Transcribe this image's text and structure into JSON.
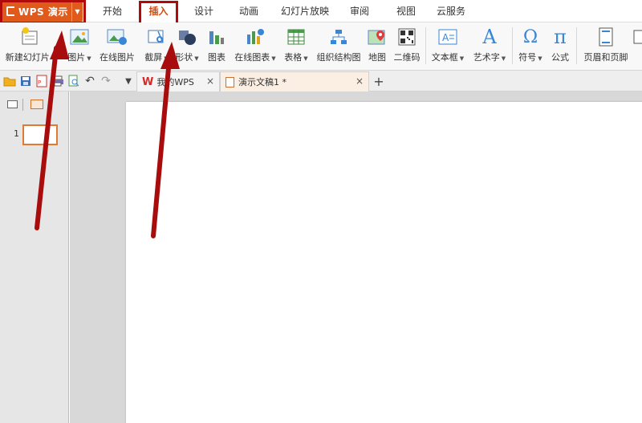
{
  "app": {
    "title": "WPS 演示",
    "brand_color": "#e05a1c",
    "highlight_color": "#b10a0a"
  },
  "menu_tabs": [
    "开始",
    "插入",
    "设计",
    "动画",
    "幻灯片放映",
    "审阅",
    "视图",
    "云服务"
  ],
  "active_menu_tab": "插入",
  "ribbon": {
    "buttons": [
      {
        "label": "新建幻灯片",
        "icon": "new-slide-icon",
        "has_dropdown": true
      },
      {
        "label": "图片",
        "icon": "picture-icon",
        "has_dropdown": true
      },
      {
        "label": "在线图片",
        "icon": "online-picture-icon",
        "has_dropdown": false
      },
      {
        "label": "截屏",
        "icon": "screenshot-icon",
        "has_dropdown": true
      },
      {
        "label": "形状",
        "icon": "shapes-icon",
        "has_dropdown": true
      },
      {
        "label": "图表",
        "icon": "chart-icon",
        "has_dropdown": false
      },
      {
        "label": "在线图表",
        "icon": "online-chart-icon",
        "has_dropdown": true
      },
      {
        "label": "表格",
        "icon": "table-icon",
        "has_dropdown": true
      },
      {
        "label": "组织结构图",
        "icon": "org-chart-icon",
        "has_dropdown": false
      },
      {
        "label": "地图",
        "icon": "map-icon",
        "has_dropdown": false
      },
      {
        "label": "二维码",
        "icon": "qr-code-icon",
        "has_dropdown": false
      },
      {
        "label": "文本框",
        "icon": "textbox-icon",
        "has_dropdown": true
      },
      {
        "label": "艺术字",
        "icon": "wordart-icon",
        "has_dropdown": true
      },
      {
        "label": "符号",
        "icon": "symbol-icon",
        "has_dropdown": true
      },
      {
        "label": "公式",
        "icon": "formula-icon",
        "has_dropdown": false
      },
      {
        "label": "页眉和页脚",
        "icon": "header-footer-icon",
        "has_dropdown": false
      }
    ]
  },
  "doc_tabs": [
    {
      "label": "我的WPS",
      "icon": "wps-logo-icon",
      "active": false
    },
    {
      "label": "演示文稿1 *",
      "icon": "presentation-file-icon",
      "active": true
    }
  ],
  "slides": [
    {
      "number": "1"
    }
  ]
}
